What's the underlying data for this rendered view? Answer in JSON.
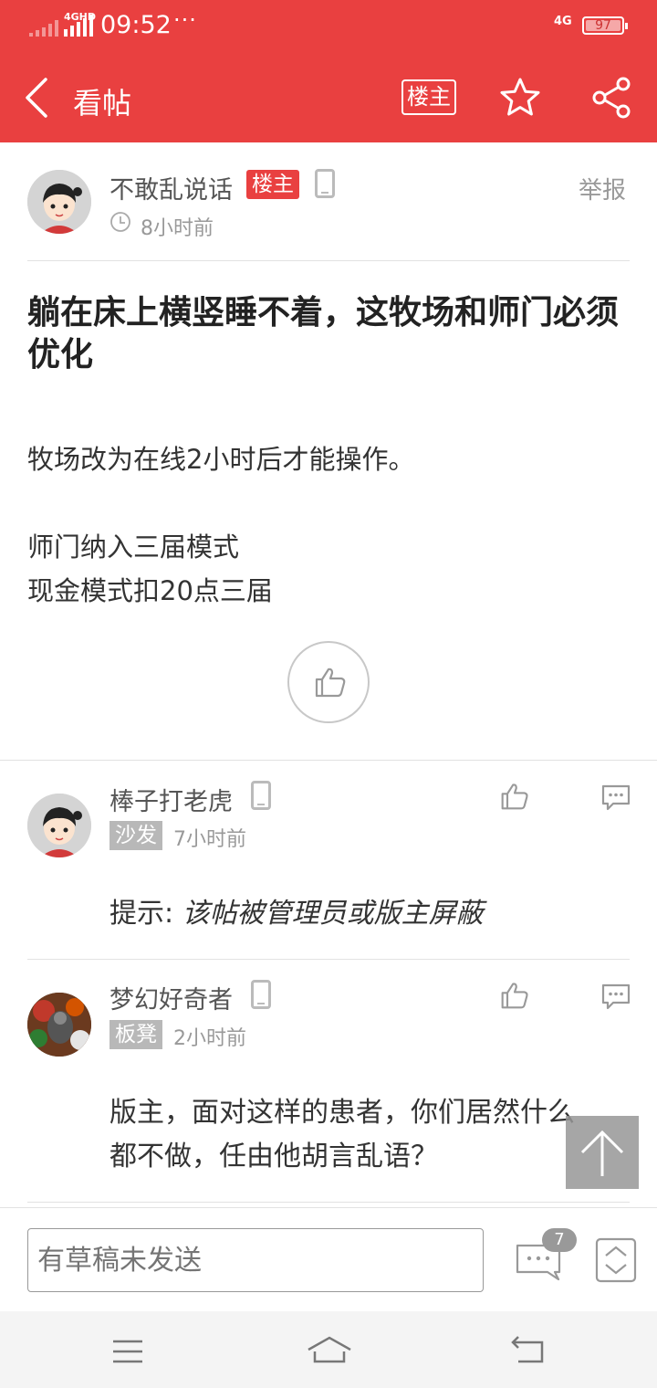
{
  "status_bar": {
    "time": "09:52",
    "more": "···",
    "network": "4G",
    "network_hd": "4GHD",
    "battery": "97"
  },
  "header": {
    "title": "看帖",
    "owner_button": "楼主"
  },
  "post": {
    "author": "不敢乱说话",
    "author_badge": "楼主",
    "time": "8小时前",
    "report": "举报",
    "title": "躺在床上横竖睡不着，这牧场和师门必须优化",
    "body": [
      "牧场改为在线2小时后才能操作。",
      "师门纳入三届模式",
      "现金模式扣20点三届"
    ]
  },
  "replies": [
    {
      "author": "棒子打老虎",
      "floor": "沙发",
      "time": "7小时前",
      "prefix": "提示: ",
      "text": "该帖被管理员或版主屏蔽"
    },
    {
      "author": "梦幻好奇者",
      "floor": "板凳",
      "time": "2小时前",
      "lines": [
        "版主，面对这样的患者，你们居然什么",
        "都不做，任由他胡言乱语？"
      ]
    }
  ],
  "input_bar": {
    "placeholder": "有草稿未发送",
    "comment_count": "7"
  },
  "colors": {
    "brand": "#e94040"
  }
}
